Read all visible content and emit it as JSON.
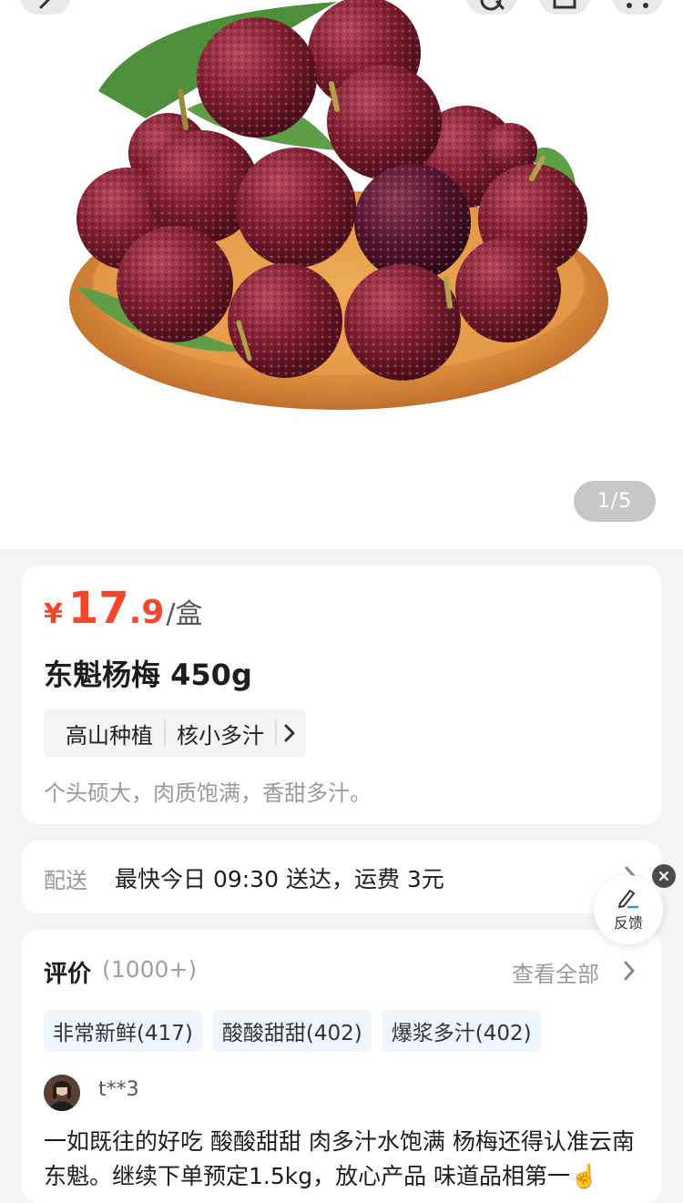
{
  "header": {
    "buttons": [
      {
        "icon": "back-icon"
      },
      {
        "icon": "search-icon"
      },
      {
        "icon": "share-icon"
      },
      {
        "icon": "more-icon"
      }
    ]
  },
  "gallery": {
    "counter": "1/5"
  },
  "product": {
    "currency": "¥",
    "price_int": "17",
    "price_dec": ".9",
    "unit": "/盒",
    "title": "东魁杨梅 450g",
    "tags": [
      "高山种植",
      "核小多汁"
    ],
    "description": "个头硕大，肉质饱满，香甜多汁。"
  },
  "shipping": {
    "label": "配送",
    "text": "最快今日 09:30 送达，运费 3元"
  },
  "reviews": {
    "title": "评价",
    "count": "(1000+)",
    "see_all": "查看全部",
    "chips": [
      "非常新鲜(417)",
      "酸酸甜甜(402)",
      "爆浆多汁(402)"
    ],
    "first": {
      "user": "t**3",
      "text": "一如既往的好吃 酸酸甜甜 肉多汁水饱满 杨梅还得认准云南东魁。继续下单预定1.5kg，放心产品 味道品相第一☝️"
    }
  },
  "feedback": {
    "label": "反馈"
  },
  "colors": {
    "price": "#f3462a",
    "chip_bg": "#eef5fc",
    "page_bg": "#f4f4f4"
  }
}
